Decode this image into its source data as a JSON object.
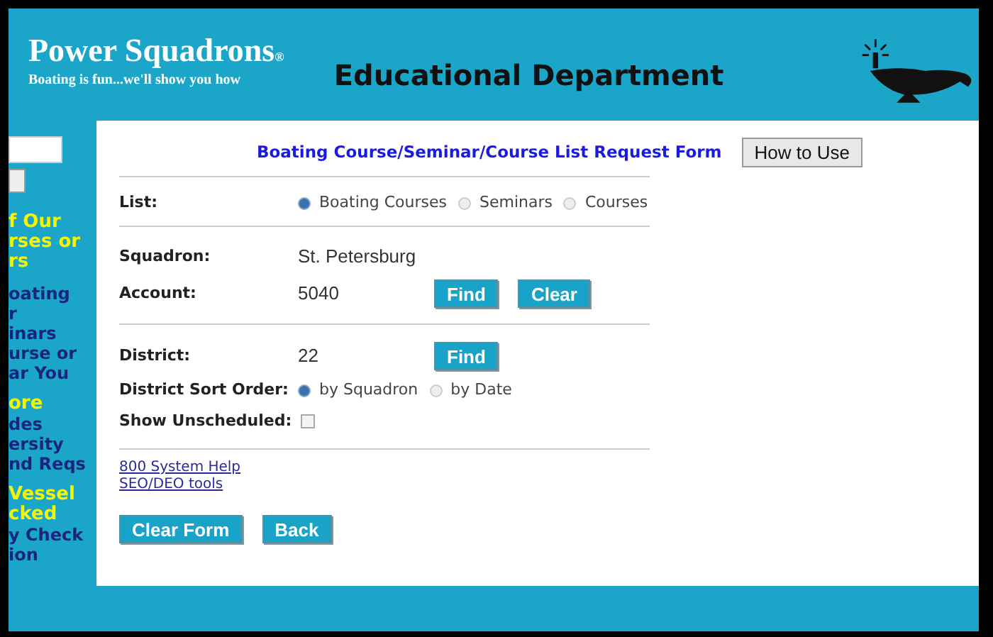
{
  "header": {
    "org_name": "Power Squadrons",
    "org_mark": "®",
    "tagline": "Boating is fun...we'll show you how",
    "department": "Educational Department"
  },
  "sidebar": {
    "items": [
      {
        "text": "f Our",
        "kind": "highlight"
      },
      {
        "text": "rses or",
        "kind": "highlight"
      },
      {
        "text": "rs",
        "kind": "highlight"
      },
      {
        "text": "oating",
        "kind": "link"
      },
      {
        "text": "r",
        "kind": "link"
      },
      {
        "text": "inars",
        "kind": "link"
      },
      {
        "text": "urse or",
        "kind": "link"
      },
      {
        "text": "ar You",
        "kind": "link"
      },
      {
        "text": "ore",
        "kind": "highlight"
      },
      {
        "text": "des",
        "kind": "link"
      },
      {
        "text": "ersity",
        "kind": "link"
      },
      {
        "text": "nd Reqs",
        "kind": "link"
      },
      {
        "text": "Vessel",
        "kind": "highlight"
      },
      {
        "text": "cked",
        "kind": "highlight"
      },
      {
        "text": "y Check",
        "kind": "link"
      },
      {
        "text": "ion",
        "kind": "link"
      }
    ]
  },
  "form": {
    "title": "Boating Course/Seminar/Course List Request Form",
    "help_button": "How to Use",
    "list": {
      "label": "List:",
      "options": [
        {
          "label": "Boating Courses",
          "selected": true
        },
        {
          "label": "Seminars",
          "selected": false
        },
        {
          "label": "Courses",
          "selected": false
        }
      ]
    },
    "squadron": {
      "label": "Squadron:",
      "value": "St. Petersburg"
    },
    "account": {
      "label": "Account:",
      "value": "5040",
      "buttons": [
        "Find",
        "Clear"
      ]
    },
    "district": {
      "label": "District:",
      "value": "22",
      "button": "Find"
    },
    "sort_order": {
      "label": "District Sort Order:",
      "options": [
        {
          "label": "by Squadron",
          "selected": true
        },
        {
          "label": "by Date",
          "selected": false
        }
      ]
    },
    "show_unscheduled": {
      "label": "Show Unscheduled:",
      "checked": false
    },
    "links": [
      "800 System Help",
      "SEO/DEO tools"
    ],
    "buttons": [
      "Clear Form",
      "Back"
    ]
  }
}
